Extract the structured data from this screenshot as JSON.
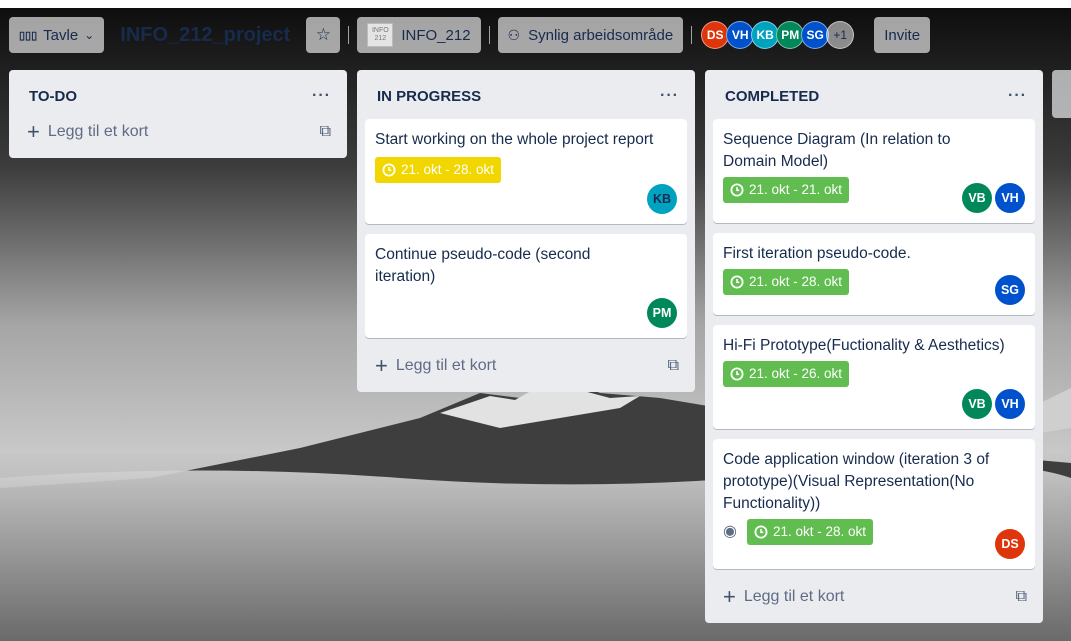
{
  "header": {
    "board_view_label": "Tavle",
    "board_name": "INFO_212_project",
    "workspace_label": "INFO_212",
    "workspace_thumb_text": "INFO 212",
    "visibility_label": "Synlig arbeidsområde",
    "members": [
      {
        "initials": "DS",
        "color": "#de350b"
      },
      {
        "initials": "VH",
        "color": "#0052cc"
      },
      {
        "initials": "KB",
        "color": "#00a3bf"
      },
      {
        "initials": "PM",
        "color": "#00875a"
      },
      {
        "initials": "SG",
        "color": "#0052cc"
      }
    ],
    "more_members": "+1",
    "invite_label": "Invite"
  },
  "colors": {
    "due_green": "#61bd4f",
    "due_yellow": "#f2d600"
  },
  "lists": {
    "todo": {
      "title": "TO-DO",
      "menu": "···",
      "add_card": "Legg til et kort"
    },
    "progress": {
      "title": "IN PROGRESS",
      "menu": "···",
      "add_card": "Legg til et kort",
      "cards": {
        "c1": {
          "title": "Start working on the whole project report",
          "due": "21. okt - 28. okt",
          "due_status": "yellow",
          "members": [
            "KB"
          ]
        },
        "c2": {
          "title": "Continue pseudo-code (second iteration)",
          "members": [
            "PM"
          ]
        }
      }
    },
    "completed": {
      "title": "COMPLETED",
      "menu": "···",
      "add_card": "Legg til et kort",
      "cards": {
        "c1": {
          "title": "Sequence Diagram (In relation to Domain Model)",
          "due": "21. okt - 21. okt",
          "due_status": "green",
          "members": [
            "VB",
            "VH"
          ]
        },
        "c2": {
          "title": "First iteration pseudo-code.",
          "due": "21. okt - 28. okt",
          "due_status": "green",
          "members": [
            "SG"
          ]
        },
        "c3": {
          "title": "Hi-Fi Prototype(Fuctionality & Aesthetics)",
          "due": "21. okt - 26. okt",
          "due_status": "green",
          "members": [
            "VB",
            "VH"
          ]
        },
        "c4": {
          "title": "Code application window (iteration 3 of prototype)(Visual Representation(No Functionality))",
          "due": "21. okt - 28. okt",
          "due_status": "green",
          "watching": true,
          "members": [
            "DS"
          ]
        }
      }
    }
  }
}
